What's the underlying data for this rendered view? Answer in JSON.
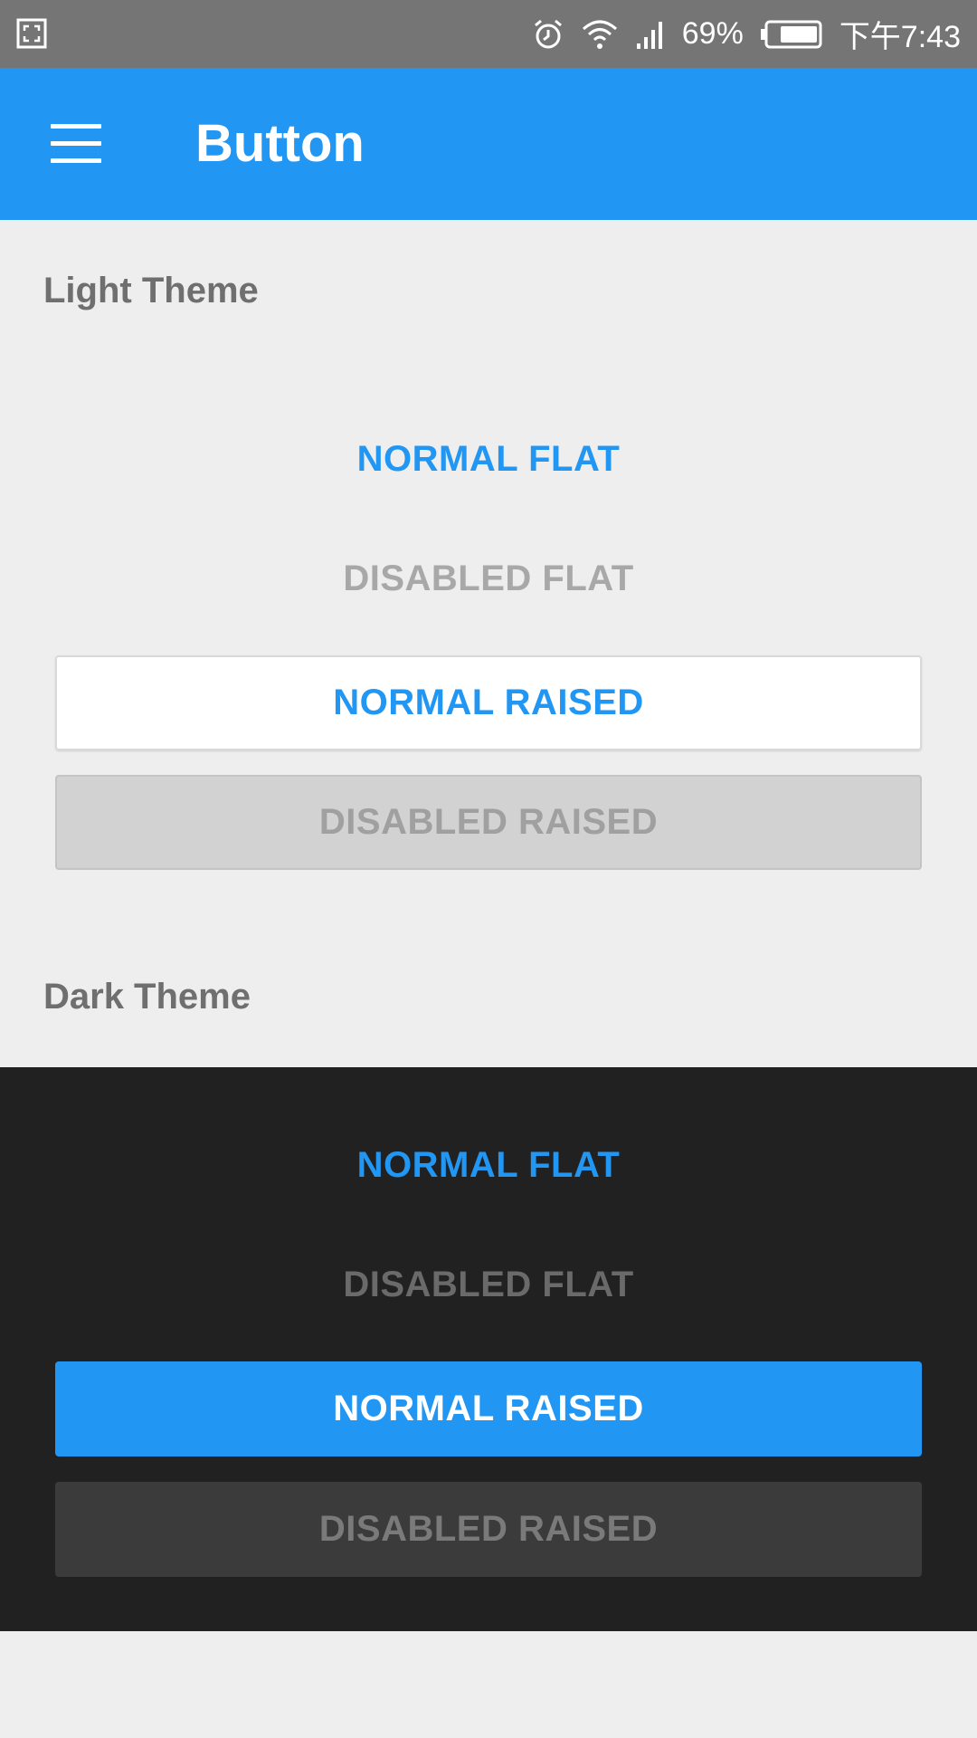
{
  "status_bar": {
    "battery_percent": "69%",
    "time": "下午7:43",
    "icons": [
      "screenshot-icon",
      "alarm-icon",
      "wifi-icon",
      "signal-icon",
      "battery-icon"
    ]
  },
  "app_bar": {
    "title": "Button",
    "menu_icon": "menu-icon"
  },
  "light_theme": {
    "label": "Light Theme",
    "normal_flat": "NORMAL FLAT",
    "disabled_flat": "DISABLED FLAT",
    "normal_raised": "NORMAL RAISED",
    "disabled_raised": "DISABLED RAISED"
  },
  "dark_theme": {
    "label": "Dark Theme",
    "normal_flat": "NORMAL FLAT",
    "disabled_flat": "DISABLED FLAT",
    "normal_raised": "NORMAL RAISED",
    "disabled_raised": "DISABLED RAISED"
  },
  "colors": {
    "accent": "#2196f3",
    "status_bar": "#757575",
    "background": "#eeeeee",
    "dark_panel": "#212121"
  }
}
